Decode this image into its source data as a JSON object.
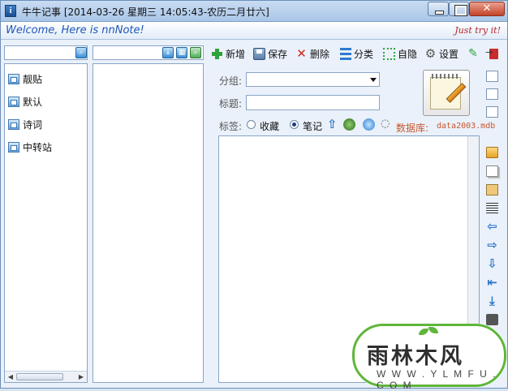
{
  "window": {
    "title": "牛牛记事 [2014-03-26 星期三 14:05:43-农历二月廿六]"
  },
  "banner": {
    "welcome": "Welcome, Here is nnNote!",
    "tagline": "Just try it!"
  },
  "categories": [
    {
      "label": "靓贴"
    },
    {
      "label": "默认"
    },
    {
      "label": "诗词"
    },
    {
      "label": "中转站"
    }
  ],
  "toolbar": {
    "add": "新增",
    "save": "保存",
    "delete": "删除",
    "classify": "分类",
    "auto_hide": "自隐",
    "settings": "设置"
  },
  "form": {
    "group_label": "分组:",
    "group_value": "",
    "title_label": "标题:",
    "title_value": "",
    "tag_label": "标签:",
    "tag_options": [
      "收藏",
      "笔记"
    ],
    "tag_selected": "笔记",
    "db_label": "数据库:",
    "db_value": "data2003.mdb"
  },
  "editor": {
    "content": ""
  },
  "watermark": {
    "title": "雨林木风",
    "url": "W W W . Y L M F U . C O M"
  }
}
